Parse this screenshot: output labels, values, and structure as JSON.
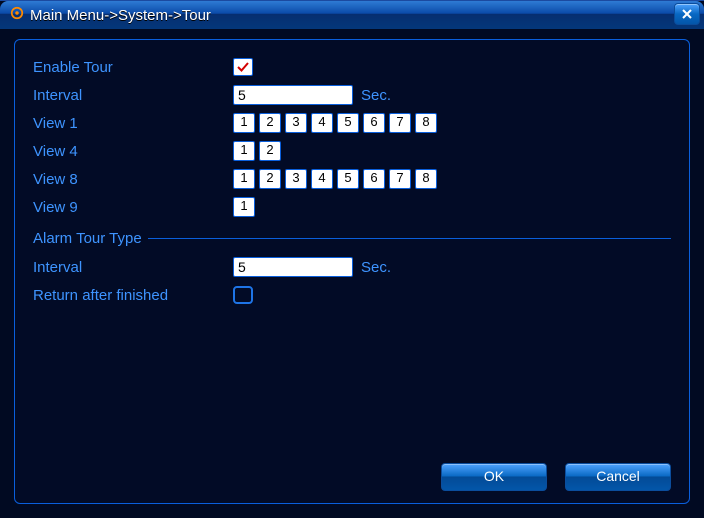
{
  "title": "Main Menu->System->Tour",
  "labels": {
    "enable_tour": "Enable Tour",
    "interval": "Interval",
    "sec": "Sec.",
    "view1": "View 1",
    "view4": "View 4",
    "view8": "View 8",
    "view9": "View 9",
    "alarm_section": "Alarm Tour Type",
    "alarm_interval": "Interval",
    "return_after": "Return after finished",
    "ok": "OK",
    "cancel": "Cancel"
  },
  "values": {
    "enable_tour_checked": true,
    "interval": "5",
    "alarm_interval": "5",
    "return_after_checked": false
  },
  "channels": {
    "view1": [
      "1",
      "2",
      "3",
      "4",
      "5",
      "6",
      "7",
      "8"
    ],
    "view4": [
      "1",
      "2"
    ],
    "view8": [
      "1",
      "2",
      "3",
      "4",
      "5",
      "6",
      "7",
      "8"
    ],
    "view9": [
      "1"
    ]
  }
}
